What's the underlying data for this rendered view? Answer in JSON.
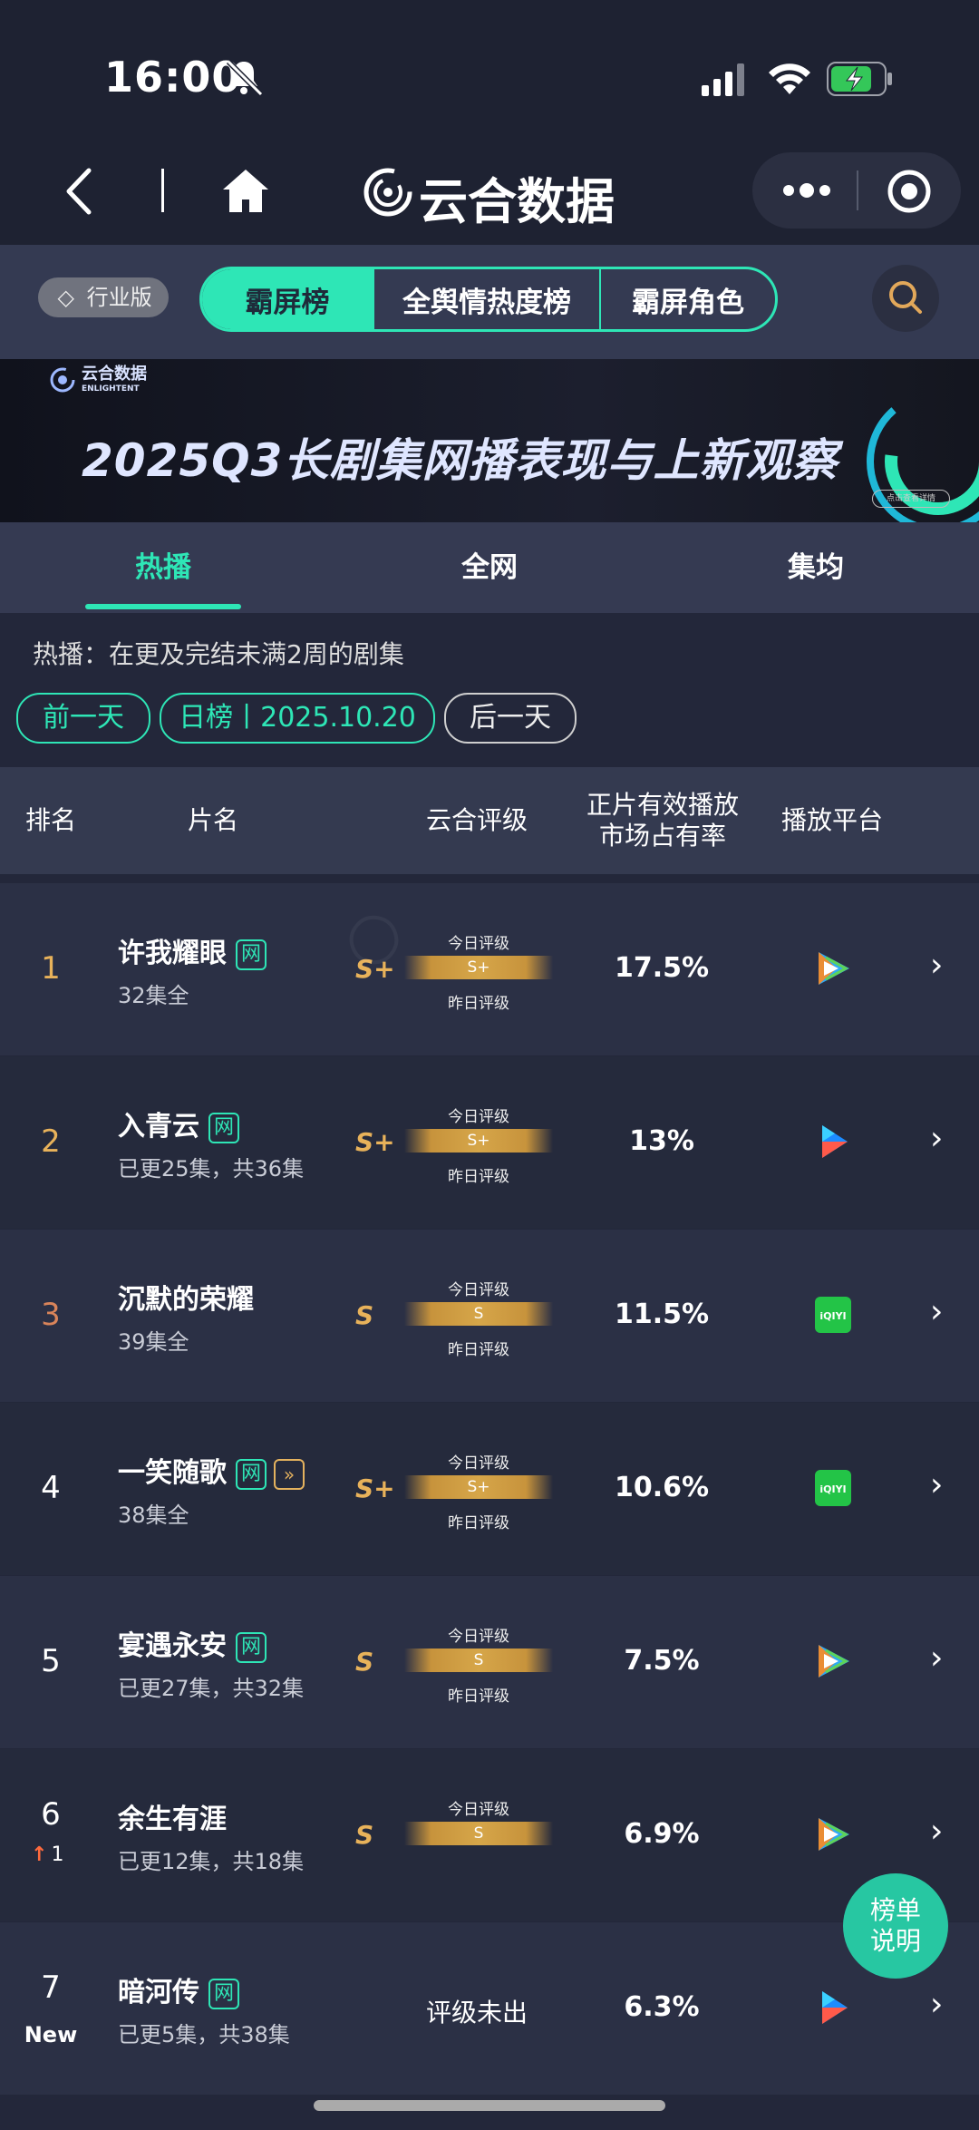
{
  "status_bar": {
    "time": "16:00"
  },
  "nav": {
    "title": "云合数据"
  },
  "edition_badge": "行业版",
  "segments": [
    {
      "label": "霸屏榜",
      "active": true
    },
    {
      "label": "全舆情热度榜",
      "active": false
    },
    {
      "label": "霸屏角色",
      "active": false
    }
  ],
  "banner": {
    "title": "2025Q3长剧集网播表现与上新观察",
    "logo_cn": "云合数据",
    "logo_en": "ENLIGHTENT",
    "button": "点击查看详情"
  },
  "sub_tabs": [
    {
      "label": "热播",
      "active": true
    },
    {
      "label": "全网",
      "active": false
    },
    {
      "label": "集均",
      "active": false
    }
  ],
  "description": "热播：在更及完结未满2周的剧集",
  "date_nav": {
    "prev": "前一天",
    "current": "日榜丨2025.10.20",
    "next": "后一天"
  },
  "table_headers": {
    "rank": "排名",
    "title": "片名",
    "rating": "云合评级",
    "share": "正片有效播放\n市场占有率",
    "platform": "播放平台"
  },
  "rating_labels": {
    "today": "今日评级",
    "yesterday": "昨日评级"
  },
  "badge_labels": {
    "wang": "网"
  },
  "rows": [
    {
      "rank": "1",
      "title": "许我耀眼",
      "episodes": "32集全",
      "grade": "S+",
      "bar_grade": "S+",
      "share": "17.5%",
      "platform": "tencent",
      "rank_color": "#e8b25a",
      "badges": [
        "wang"
      ]
    },
    {
      "rank": "2",
      "title": "入青云",
      "episodes": "已更25集，共36集",
      "grade": "S+",
      "bar_grade": "S+",
      "share": "13%",
      "platform": "youku",
      "rank_color": "#e8b25a",
      "badges": [
        "wang"
      ]
    },
    {
      "rank": "3",
      "title": "沉默的荣耀",
      "episodes": "39集全",
      "grade": "S",
      "bar_grade": "S",
      "share": "11.5%",
      "platform": "iqiyi",
      "rank_color": "#d9845a",
      "badges": []
    },
    {
      "rank": "4",
      "title": "一笑随歌",
      "episodes": "38集全",
      "grade": "S+",
      "bar_grade": "S+",
      "share": "10.6%",
      "platform": "iqiyi",
      "rank_color": "#ffffff",
      "badges": [
        "wang",
        "dual"
      ]
    },
    {
      "rank": "5",
      "title": "宴遇永安",
      "episodes": "已更27集，共32集",
      "grade": "S",
      "bar_grade": "S",
      "share": "7.5%",
      "platform": "tencent",
      "rank_color": "#ffffff",
      "badges": [
        "wang"
      ]
    },
    {
      "rank": "6",
      "rank_change": "1",
      "title": "余生有涯",
      "episodes": "已更12集，共18集",
      "grade": "S",
      "bar_grade": "S",
      "share": "6.9%",
      "platform": "tencent",
      "rank_color": "#ffffff",
      "badges": [],
      "no_yesterday": true
    },
    {
      "rank": "7",
      "rank_new": "New",
      "title": "暗河传",
      "episodes": "已更5集，共38集",
      "grade_text": "评级未出",
      "share": "6.3%",
      "platform": "youku",
      "rank_color": "#ffffff",
      "badges": [
        "wang"
      ]
    }
  ],
  "fab": {
    "line1": "榜单",
    "line2": "说明"
  },
  "colors": {
    "accent": "#2ee6b6",
    "gold": "#e8b25a",
    "background": "#23273a"
  }
}
